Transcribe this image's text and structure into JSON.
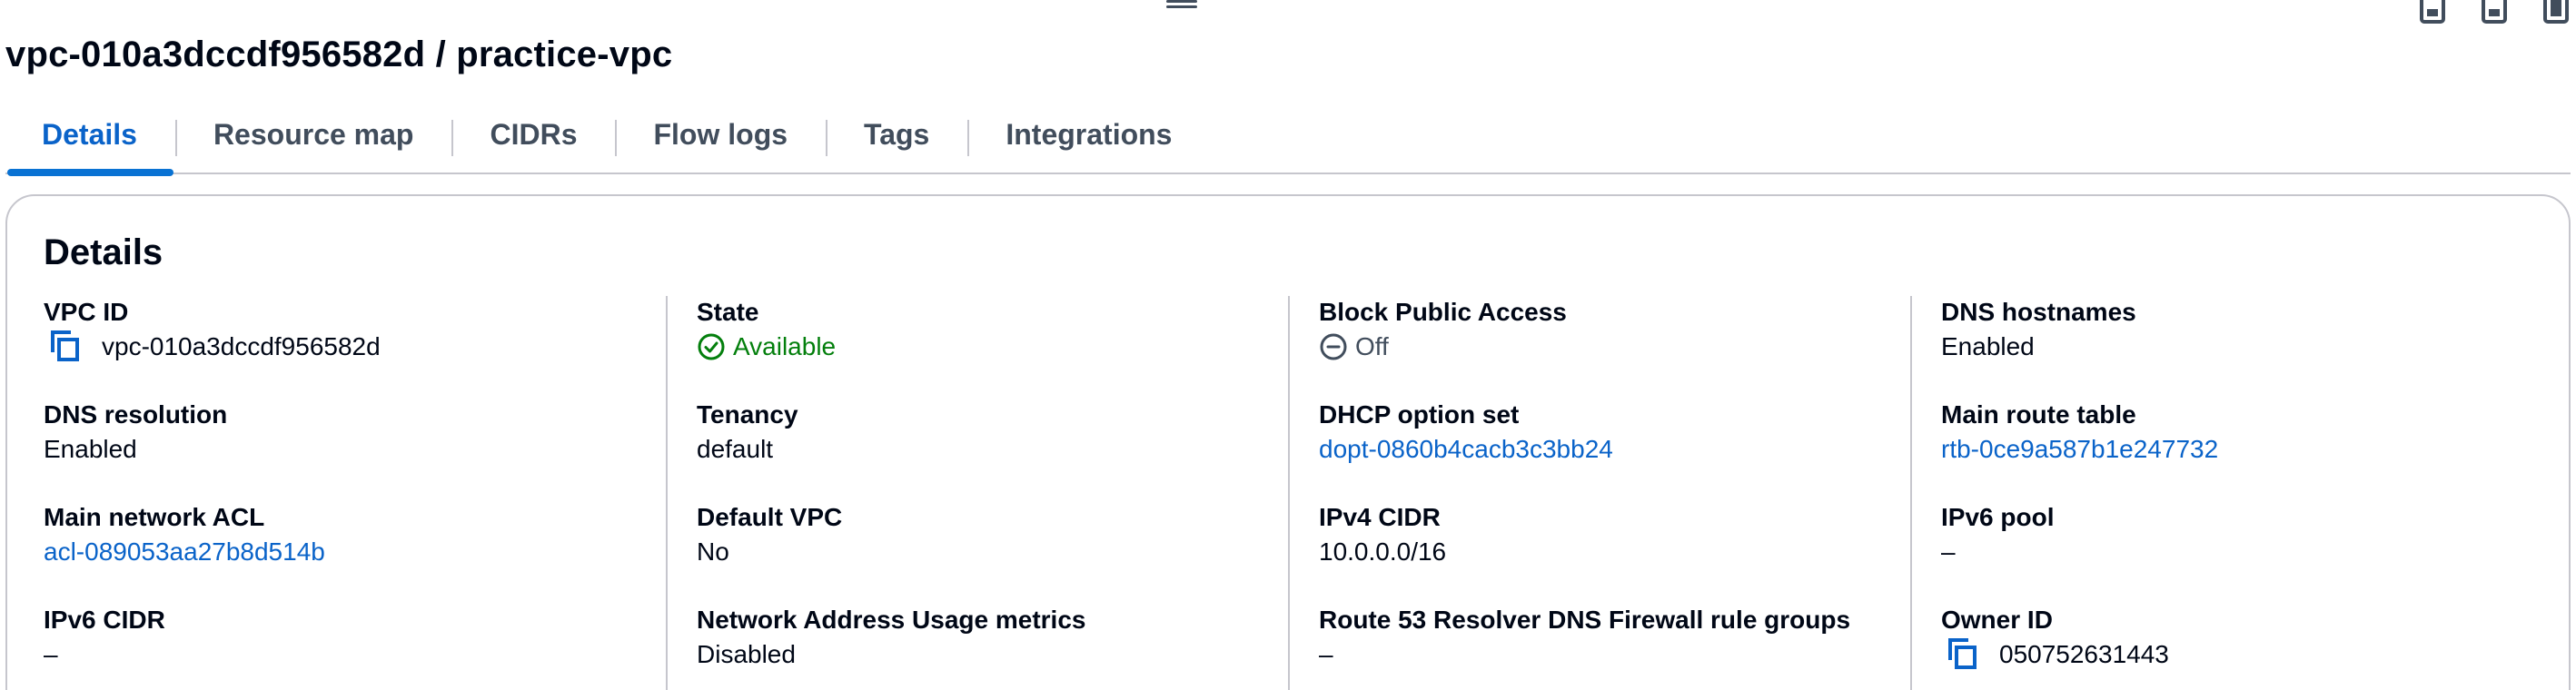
{
  "header": {
    "title": "vpc-010a3dccdf956582d / practice-vpc"
  },
  "tabs": [
    {
      "label": "Details"
    },
    {
      "label": "Resource map"
    },
    {
      "label": "CIDRs"
    },
    {
      "label": "Flow logs"
    },
    {
      "label": "Tags"
    },
    {
      "label": "Integrations"
    }
  ],
  "details": {
    "title": "Details",
    "columns": [
      [
        {
          "label": "VPC ID",
          "value": "vpc-010a3dccdf956582d"
        },
        {
          "label": "DNS resolution",
          "value": "Enabled"
        },
        {
          "label": "Main network ACL",
          "value": "acl-089053aa27b8d514b"
        },
        {
          "label": "IPv6 CIDR",
          "value": "–"
        }
      ],
      [
        {
          "label": "State",
          "value": "Available"
        },
        {
          "label": "Tenancy",
          "value": "default"
        },
        {
          "label": "Default VPC",
          "value": "No"
        },
        {
          "label": "Network Address Usage metrics",
          "value": "Disabled"
        }
      ],
      [
        {
          "label": "Block Public Access",
          "value": "Off"
        },
        {
          "label": "DHCP option set",
          "value": "dopt-0860b4cacb3c3bb24"
        },
        {
          "label": "IPv4 CIDR",
          "value": "10.0.0.0/16"
        },
        {
          "label": "Route 53 Resolver DNS Firewall rule groups",
          "value": "–"
        }
      ],
      [
        {
          "label": "DNS hostnames",
          "value": "Enabled"
        },
        {
          "label": "Main route table",
          "value": "rtb-0ce9a587b1e247732"
        },
        {
          "label": "IPv6 pool",
          "value": "–"
        },
        {
          "label": "Owner ID",
          "value": "050752631443"
        }
      ]
    ]
  },
  "colors": {
    "link": "#0a63c9",
    "success": "#037f0c",
    "text": "#000716",
    "muted": "#414d5c",
    "divider": "#c6c6cd"
  },
  "icons": {
    "copy": "copy-icon",
    "available": "check-circle-icon",
    "off": "minus-circle-icon",
    "drag": "drag-handle-icon",
    "layout": [
      "split-panel-bottom-icon",
      "split-panel-mid-icon",
      "split-panel-full-icon"
    ]
  }
}
